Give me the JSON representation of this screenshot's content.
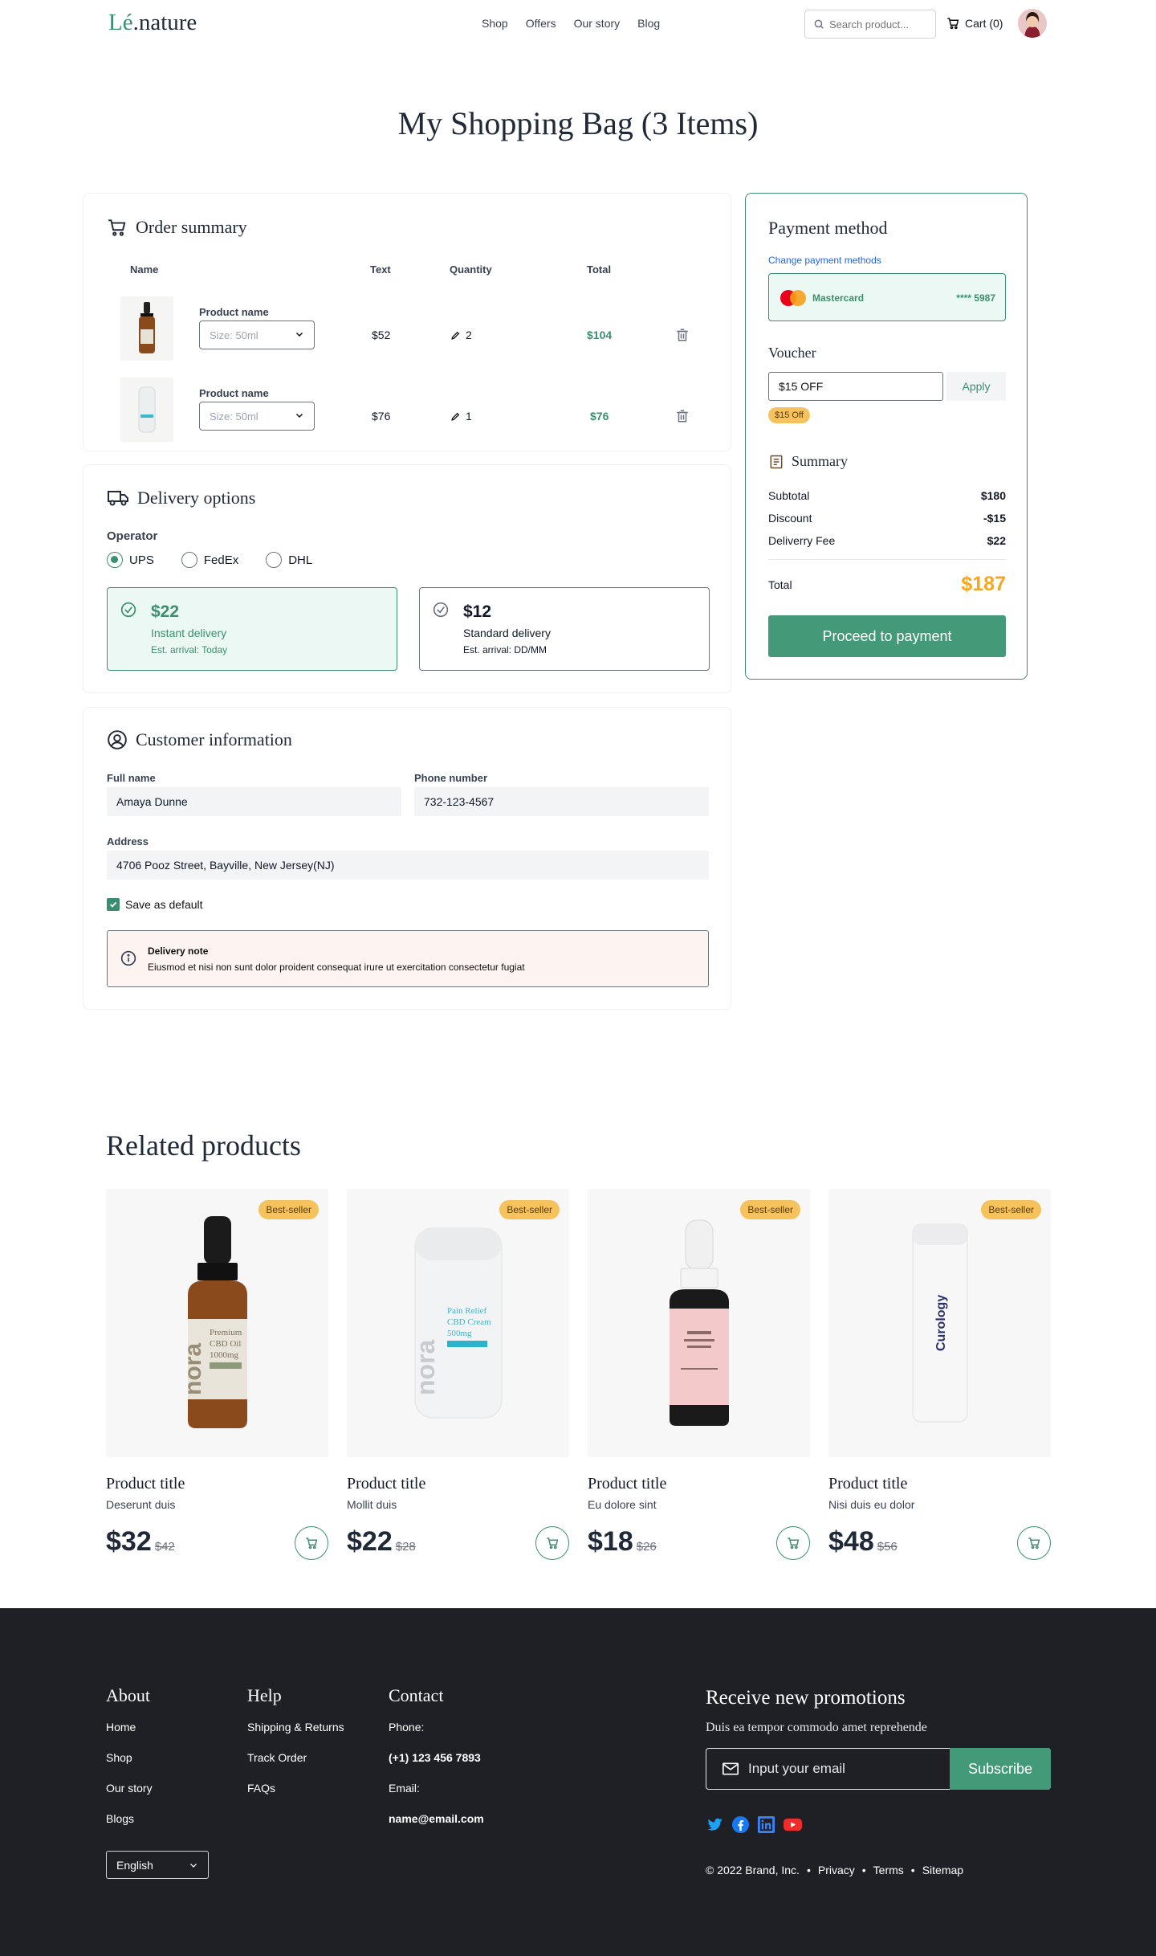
{
  "header": {
    "logo_main": "Lé",
    "logo_dot": ".",
    "logo_rest": "nature",
    "nav": [
      "Shop",
      "Offers",
      "Our story",
      "Blog"
    ],
    "search_placeholder": "Search product...",
    "cart_label": "Cart (0)"
  },
  "page_title": "My Shopping Bag (3 Items)",
  "order_summary": {
    "title": "Order summary",
    "columns": [
      "Name",
      "Text",
      "Quantity",
      "Total"
    ],
    "items": [
      {
        "name": "Product name",
        "size": "Size: 50ml",
        "price": "$52",
        "qty": "2",
        "total": "$104"
      },
      {
        "name": "Product name",
        "size": "Size: 50ml",
        "price": "$76",
        "qty": "1",
        "total": "$76"
      }
    ]
  },
  "delivery": {
    "title": "Delivery options",
    "operator_label": "Operator",
    "operators": [
      "UPS",
      "FedEx",
      "DHL"
    ],
    "selected_operator": "UPS",
    "options": [
      {
        "price": "$22",
        "name": "Instant delivery",
        "eta": "Est. arrival: Today",
        "selected": true
      },
      {
        "price": "$12",
        "name": "Standard delivery",
        "eta": "Est. arrival: DD/MM",
        "selected": false
      }
    ]
  },
  "customer": {
    "title": "Customer information",
    "full_name_label": "Full name",
    "full_name": "Amaya Dunne",
    "phone_label": "Phone number",
    "phone": "732-123-4567",
    "address_label": "Address",
    "address": "4706 Pooz Street, Bayville, New Jersey(NJ)",
    "save_default": "Save as default",
    "note_title": "Delivery note",
    "note_text": "Eiusmod et nisi non sunt dolor proident consequat irure ut exercitation consectetur fugiat"
  },
  "payment": {
    "title": "Payment method",
    "change_link": "Change payment methods",
    "card_brand": "Mastercard",
    "card_number": "**** 5987",
    "voucher_label": "Voucher",
    "voucher_value": "$15 OFF",
    "apply_label": "Apply",
    "voucher_badge": "$15 Off",
    "summary_title": "Summary",
    "rows": [
      {
        "label": "Subtotal",
        "value": "$180"
      },
      {
        "label": "Discount",
        "value": "-$15"
      },
      {
        "label": "Deliverry Fee",
        "value": "$22"
      }
    ],
    "total_label": "Total",
    "total_value": "$187",
    "proceed_label": "Proceed to payment"
  },
  "related": {
    "title": "Related products",
    "products": [
      {
        "badge": "Best-seller",
        "title": "Product title",
        "subtitle": "Deserunt duis",
        "price": "$32",
        "old_price": "$42"
      },
      {
        "badge": "Best-seller",
        "title": "Product title",
        "subtitle": "Mollit duis",
        "price": "$22",
        "old_price": "$28"
      },
      {
        "badge": "Best-seller",
        "title": "Product title",
        "subtitle": "Eu dolore sint",
        "price": "$18",
        "old_price": "$26"
      },
      {
        "badge": "Best-seller",
        "title": "Product title",
        "subtitle": "Nisi duis eu dolor",
        "price": "$48",
        "old_price": "$56"
      }
    ],
    "bottle_labels": {
      "p1_brand": "nora",
      "p1_line1": "Premium",
      "p1_line2": "CBD Oil",
      "p1_line3": "1000mg",
      "p2_brand": "nora",
      "p2_line1": "Pain Relief",
      "p2_line2": "CBD Cream",
      "p2_line3": "500mg",
      "p4_brand": "Curology"
    }
  },
  "footer": {
    "about_title": "About",
    "about_links": [
      "Home",
      "Shop",
      "Our story",
      "Blogs"
    ],
    "help_title": "Help",
    "help_links": [
      "Shipping & Returns",
      "Track Order",
      "FAQs"
    ],
    "contact_title": "Contact",
    "phone_label": "Phone:",
    "phone_value": "(+1) 123 456 7893",
    "email_label": "Email:",
    "email_value": "name@email.com",
    "language": "English",
    "promo_title": "Receive new promotions",
    "promo_sub": "Duis ea tempor commodo amet reprehende",
    "email_placeholder": "Input your email",
    "subscribe_label": "Subscribe",
    "copyright": "© 2022 Brand, Inc.",
    "legal_links": [
      "Privacy",
      "Terms",
      "Sitemap"
    ],
    "colors": {
      "bg": "#1f2025",
      "accent": "#3a8f6f"
    }
  }
}
